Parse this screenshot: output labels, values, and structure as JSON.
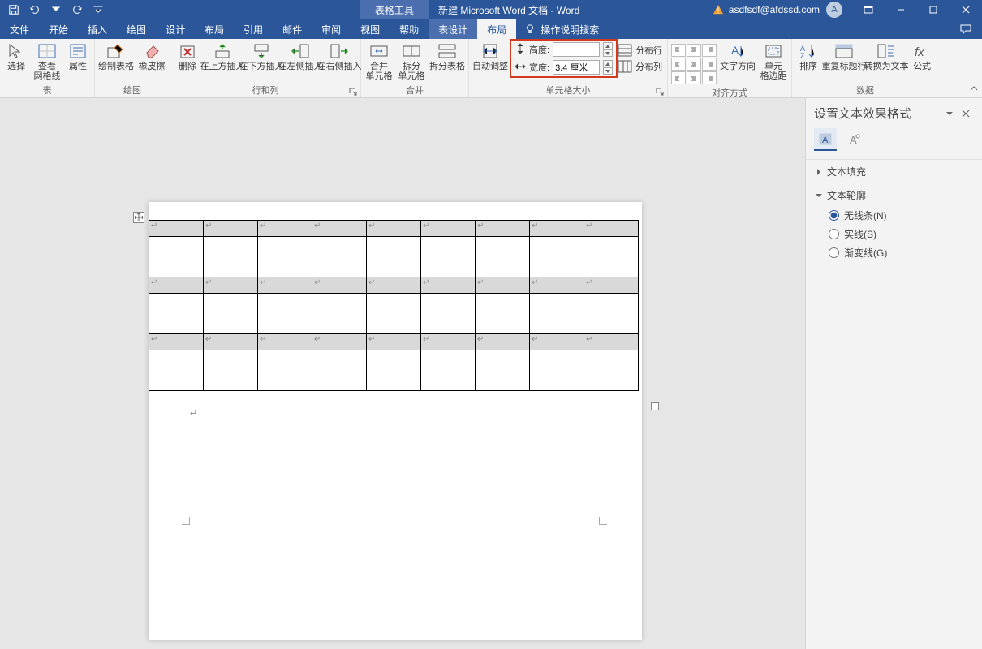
{
  "titlebar": {
    "table_tools": "表格工具",
    "doc_title": "新建 Microsoft Word 文档  -  Word",
    "user_email": "asdfsdf@afdssd.com",
    "avatar_initial": "A"
  },
  "tabs": {
    "file": "文件",
    "home": "开始",
    "insert": "插入",
    "draw": "绘图",
    "design": "设计",
    "layout": "布局",
    "references": "引用",
    "mail": "邮件",
    "review": "审阅",
    "view": "视图",
    "help": "帮助",
    "table_design": "表设计",
    "table_layout": "布局",
    "tell_me": "操作说明搜索"
  },
  "ribbon": {
    "groups": {
      "table": {
        "label": "表",
        "select": "选择",
        "view_grid": "查看\n网格线",
        "properties": "属性"
      },
      "draw": {
        "label": "绘图",
        "draw_table": "绘制表格",
        "eraser": "橡皮擦"
      },
      "rows_cols": {
        "label": "行和列",
        "delete": "删除",
        "insert_above": "在上方插入",
        "insert_below": "在下方插入",
        "insert_left": "在左侧插入",
        "insert_right": "在右侧插入"
      },
      "merge": {
        "label": "合并",
        "merge_cells": "合并\n单元格",
        "split_cells": "拆分\n单元格",
        "split_table": "拆分表格"
      },
      "cell_size": {
        "label": "单元格大小",
        "auto_fit": "自动调整",
        "height_label": "高度:",
        "height_value": "",
        "width_label": "宽度:",
        "width_value": "3.4 厘米",
        "dist_rows": "分布行",
        "dist_cols": "分布列"
      },
      "alignment": {
        "label": "对齐方式",
        "text_direction": "文字方向",
        "cell_margins": "单元\n格边距"
      },
      "data": {
        "label": "数据",
        "sort": "排序",
        "repeat_header": "重复标题行",
        "convert_text": "转换为文本",
        "formula": "公式"
      }
    }
  },
  "sidepane": {
    "title": "设置文本效果格式",
    "section_fill": "文本填充",
    "section_outline": "文本轮廓",
    "opt_none": "无线条(N)",
    "opt_solid": "实线(S)",
    "opt_gradient": "渐变线(G)"
  },
  "glyphs": {
    "para": "↵"
  }
}
